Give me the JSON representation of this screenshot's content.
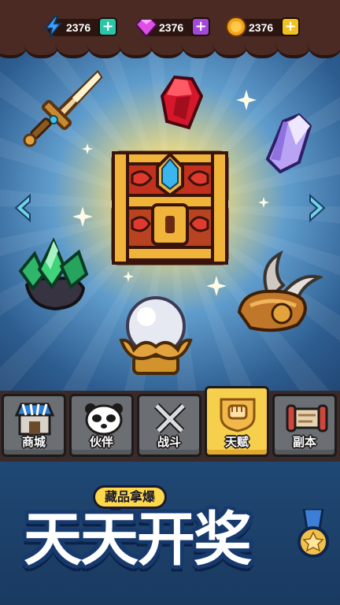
{
  "resources": [
    {
      "name": "energy",
      "icon": "lightning-icon",
      "value": "2376",
      "plus_color": "#2bc6a6"
    },
    {
      "name": "gems",
      "icon": "gem-icon",
      "value": "2376",
      "plus_color": "#a348d8"
    },
    {
      "name": "coins",
      "icon": "coin-icon",
      "value": "2376",
      "plus_color": "#f2c21c"
    }
  ],
  "items": [
    {
      "name": "sword",
      "icon": "sword-icon"
    },
    {
      "name": "ruby",
      "icon": "ruby-icon"
    },
    {
      "name": "crystal",
      "icon": "crystal-icon"
    },
    {
      "name": "treasure-chest",
      "icon": "treasure-chest-icon"
    },
    {
      "name": "emerald-ore",
      "icon": "emerald-ore-icon"
    },
    {
      "name": "crystal-ball",
      "icon": "crystal-ball-icon"
    },
    {
      "name": "winged-boot",
      "icon": "winged-boot-icon"
    }
  ],
  "tabs": [
    {
      "id": "shop",
      "label": "商城",
      "icon": "shop-icon",
      "active": false
    },
    {
      "id": "partner",
      "label": "伙伴",
      "icon": "panda-icon",
      "active": false
    },
    {
      "id": "battle",
      "label": "战斗",
      "icon": "crossed-swords-icon",
      "active": false
    },
    {
      "id": "talent",
      "label": "天赋",
      "icon": "fist-badge-icon",
      "active": true
    },
    {
      "id": "dungeon",
      "label": "副本",
      "icon": "scroll-icon",
      "active": false
    }
  ],
  "promo": {
    "bubble": "藏品拿爆",
    "headline": "天天开奖"
  },
  "colors": {
    "bar_brown": "#4a2a22",
    "tab_gray": "#6b6f73",
    "tab_active": "#f6cf4c",
    "headline_outline": "#163a6e"
  }
}
